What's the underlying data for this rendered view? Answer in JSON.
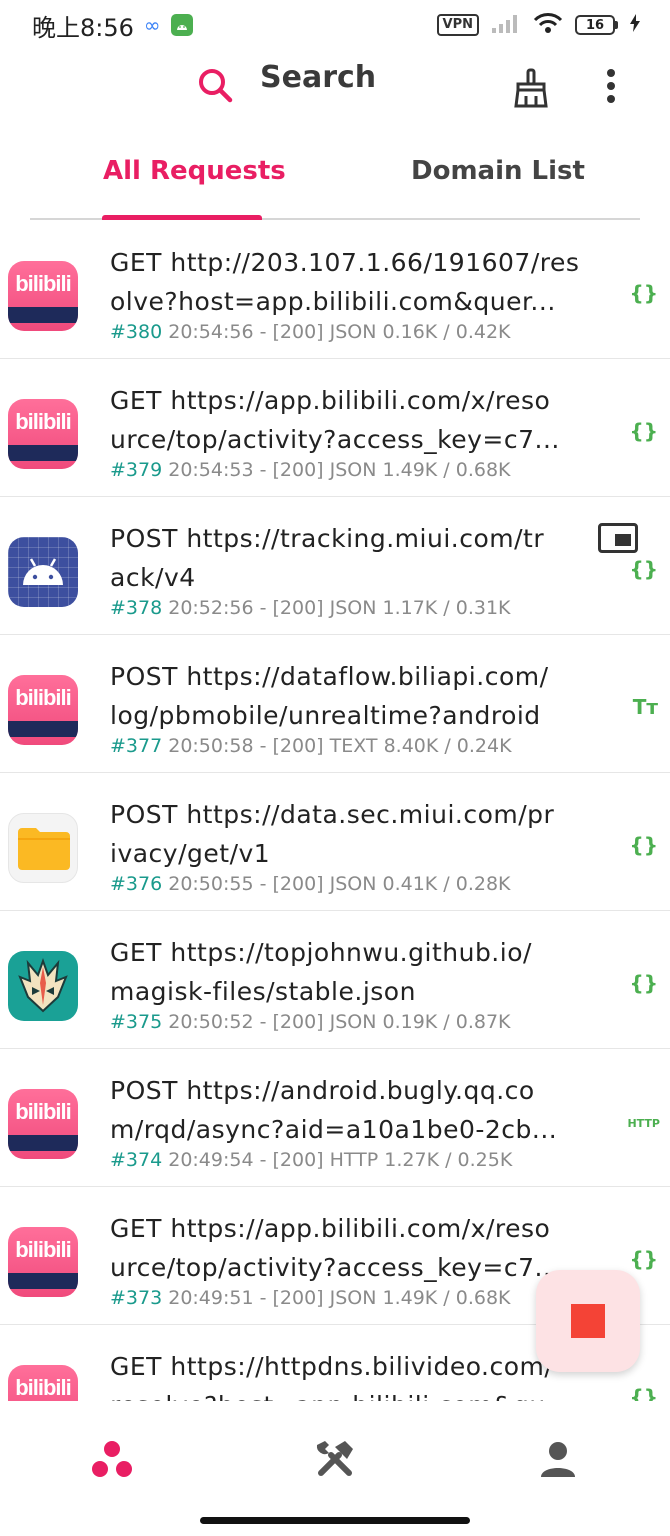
{
  "status_bar": {
    "time": "晚上8:56",
    "infinity": "∞",
    "vpn": "VPN",
    "battery": "16"
  },
  "app_bar": {
    "search_label": "Search",
    "accent_color": "#e91e63"
  },
  "tabs": [
    {
      "label": "All Requests",
      "active": true
    },
    {
      "label": "Domain List",
      "active": false
    }
  ],
  "requests": [
    {
      "line1": "GET http://203.107.1.66/191607/res",
      "line2": "olve?host=app.bilibili.com&quer...",
      "id": "#380",
      "meta": " 20:54:56 - [200] JSON 0.16K / 0.42K",
      "app": "bilibili",
      "type": "json"
    },
    {
      "line1": "GET https://app.bilibili.com/x/reso",
      "line2": "urce/top/activity?access_key=c7...",
      "id": "#379",
      "meta": " 20:54:53 - [200] JSON 1.49K / 0.68K",
      "app": "bilibili",
      "type": "json"
    },
    {
      "line1": "POST https://tracking.miui.com/tr",
      "line2": "ack/v4",
      "id": "#378",
      "meta": " 20:52:56 - [200] JSON 1.17K / 0.31K",
      "app": "android",
      "type": "json"
    },
    {
      "line1": "POST https://dataflow.biliapi.com/",
      "line2": "log/pbmobile/unrealtime?android",
      "id": "#377",
      "meta": " 20:50:58 - [200] TEXT 8.40K / 0.24K",
      "app": "bilibili",
      "type": "text"
    },
    {
      "line1": "POST https://data.sec.miui.com/pr",
      "line2": "ivacy/get/v1",
      "id": "#376",
      "meta": " 20:50:55 - [200] JSON 0.41K / 0.28K",
      "app": "files",
      "type": "json"
    },
    {
      "line1": "GET https://topjohnwu.github.io/",
      "line2": "magisk-files/stable.json",
      "id": "#375",
      "meta": " 20:50:52 - [200] JSON 0.19K / 0.87K",
      "app": "magisk",
      "type": "json"
    },
    {
      "line1": "POST https://android.bugly.qq.co",
      "line2": "m/rqd/async?aid=a10a1be0-2cb...",
      "id": "#374",
      "meta": " 20:49:54 - [200] HTTP 1.27K / 0.25K",
      "app": "bilibili",
      "type": "http"
    },
    {
      "line1": "GET https://app.bilibili.com/x/reso",
      "line2": "urce/top/activity?access_key=c7...",
      "id": "#373",
      "meta": " 20:49:51 - [200] JSON 1.49K / 0.68K",
      "app": "bilibili",
      "type": "json"
    },
    {
      "line1": "GET https://httpdns.bilivideo.com/",
      "line2": "resolve?host=app.bilibili.com&qu...",
      "id": "",
      "meta": "",
      "app": "bilibili",
      "type": "json"
    }
  ],
  "icons": {
    "bili_text": "bilibili",
    "json_glyph": "{}",
    "text_glyph": "Tт",
    "http_glyph": "HTTP"
  }
}
